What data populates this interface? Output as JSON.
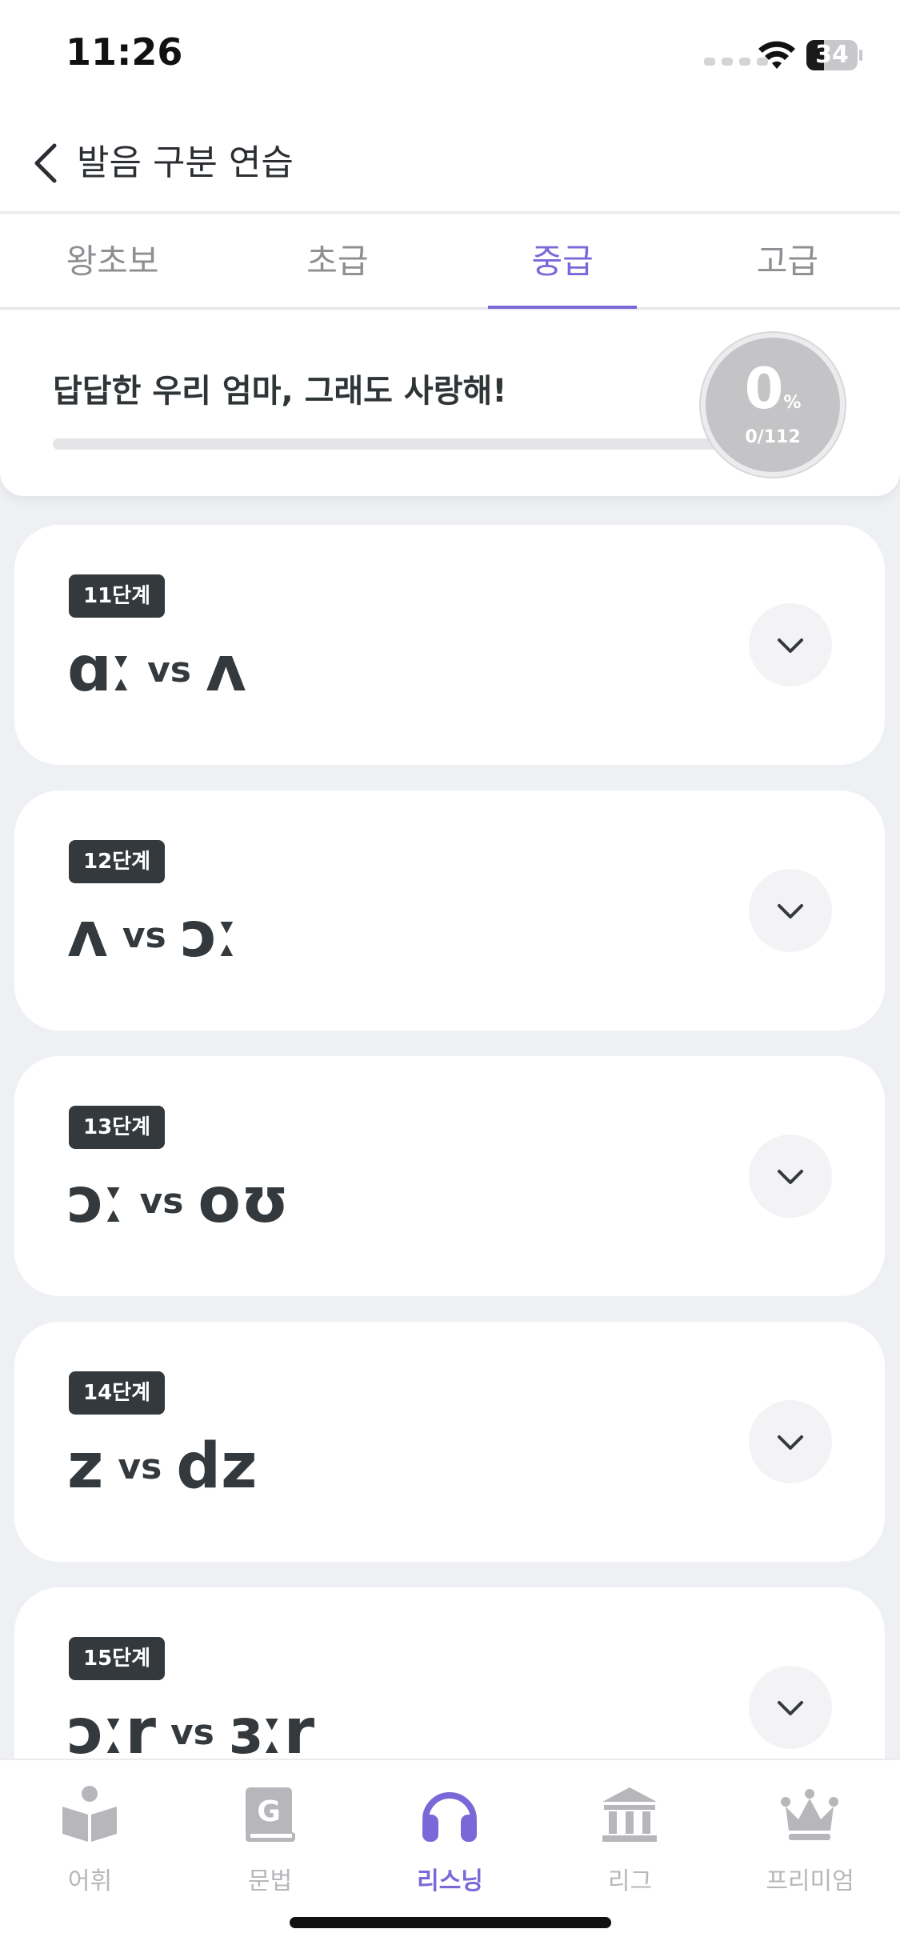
{
  "status_bar": {
    "time": "11:26",
    "battery": "34",
    "battery_level": 0.34
  },
  "header": {
    "title": "발음 구분 연습"
  },
  "tabs": [
    {
      "label": "왕초보",
      "active": false
    },
    {
      "label": "초급",
      "active": false
    },
    {
      "label": "중급",
      "active": true
    },
    {
      "label": "고급",
      "active": false
    }
  ],
  "progress": {
    "title": "답답한 우리 엄마, 그래도 사랑해!",
    "percent": "0",
    "percent_sign": "%",
    "count": "0/112",
    "fraction": 0
  },
  "levels": [
    {
      "stage": "11단계",
      "left": "ɑː",
      "vs": "vs",
      "right": "ʌ"
    },
    {
      "stage": "12단계",
      "left": "ʌ",
      "vs": "vs",
      "right": "ɔː"
    },
    {
      "stage": "13단계",
      "left": "ɔː",
      "vs": "vs",
      "right": "oʊ"
    },
    {
      "stage": "14단계",
      "left": "z",
      "vs": "vs",
      "right": "dz"
    },
    {
      "stage": "15단계",
      "left": "ɔːr",
      "vs": "vs",
      "right": "ɜːr"
    }
  ],
  "tab_bar": [
    {
      "label": "어휘",
      "icon": "book-icon",
      "active": false
    },
    {
      "label": "문법",
      "icon": "grammar-book-icon",
      "active": false
    },
    {
      "label": "리스닝",
      "icon": "headphones-icon",
      "active": true
    },
    {
      "label": "리그",
      "icon": "building-icon",
      "active": false
    },
    {
      "label": "프리미엄",
      "icon": "crown-icon",
      "active": false
    }
  ],
  "colors": {
    "accent": "#7b68d8",
    "inactive": "#b7b7bb",
    "badge": "#33393d",
    "background": "#eef0f4"
  }
}
